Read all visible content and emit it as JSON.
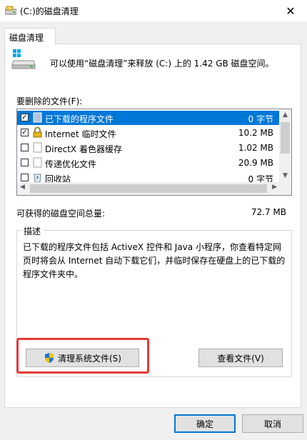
{
  "window": {
    "title": "(C:)的磁盘清理",
    "close_glyph": "✕"
  },
  "tab": {
    "label": "磁盘清理"
  },
  "info": {
    "text": "可以使用“磁盘清理”来释放 (C:) 上的 1.42 GB 磁盘空间。"
  },
  "files": {
    "label": "要删除的文件(F):",
    "items": [
      {
        "name": "已下载的程序文件",
        "size": "0 字节",
        "checked": true,
        "selected": true,
        "icon": "folder-icon"
      },
      {
        "name": "Internet 临时文件",
        "size": "10.2 MB",
        "checked": true,
        "selected": false,
        "icon": "lock-icon"
      },
      {
        "name": "DirectX 着色器缓存",
        "size": "1.02 MB",
        "checked": false,
        "selected": false,
        "icon": "blank-icon"
      },
      {
        "name": "传递优化文件",
        "size": "20.9 MB",
        "checked": false,
        "selected": false,
        "icon": "blank-icon"
      },
      {
        "name": "回收站",
        "size": "0 字节",
        "checked": false,
        "selected": false,
        "icon": "recycle-bin-icon"
      }
    ]
  },
  "gain": {
    "label": "可获得的磁盘空间总量:",
    "value": "72.7 MB"
  },
  "description": {
    "legend": "描述",
    "text": "已下载的程序文件包括 ActiveX 控件和 Java 小程序，你查看特定网页时将会从 Internet 自动下载它们，并临时保存在硬盘上的已下载的程序文件夹中。"
  },
  "buttons": {
    "clean_system": "清理系统文件(S)",
    "view_files": "查看文件(V)",
    "ok": "确定",
    "cancel": "取消"
  },
  "colors": {
    "selection": "#0078d7",
    "highlight": "#e53935"
  }
}
